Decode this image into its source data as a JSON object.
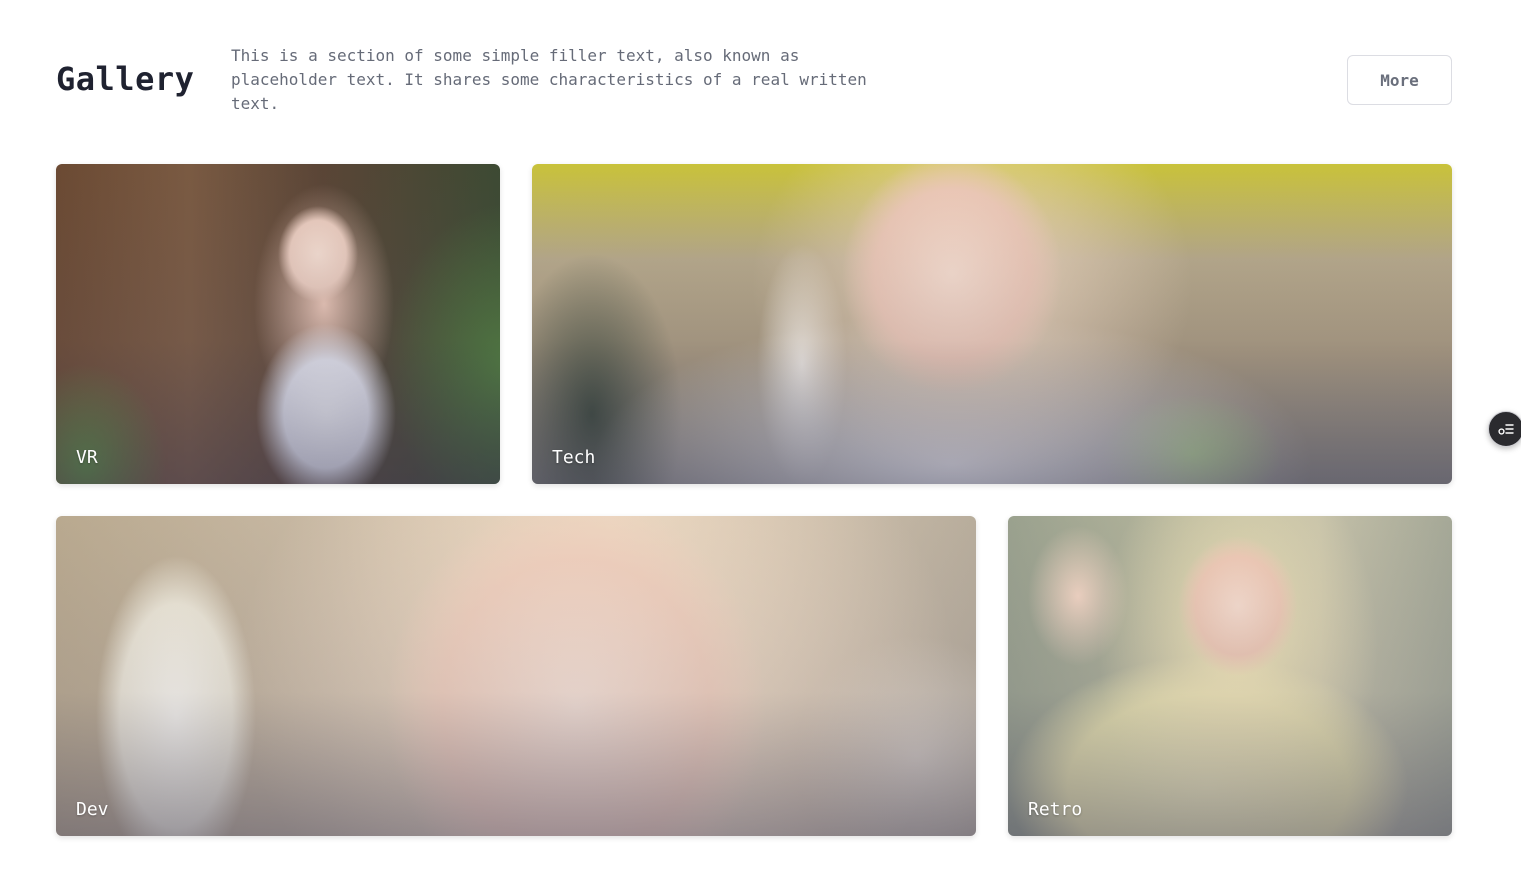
{
  "header": {
    "title": "Gallery",
    "description": "This is a section of some simple filler text, also known as placeholder text. It shares some characteristics of a real written text.",
    "more_label": "More"
  },
  "gallery": {
    "cards": [
      {
        "label": "VR"
      },
      {
        "label": "Tech"
      },
      {
        "label": "Dev"
      },
      {
        "label": "Retro"
      }
    ]
  },
  "side_button": {
    "icon": "list-settings-icon"
  },
  "colors": {
    "title": "#1f2230",
    "text_muted": "#666b78",
    "button_border": "#dcdde3",
    "fab_bg": "#2b2b2f"
  }
}
